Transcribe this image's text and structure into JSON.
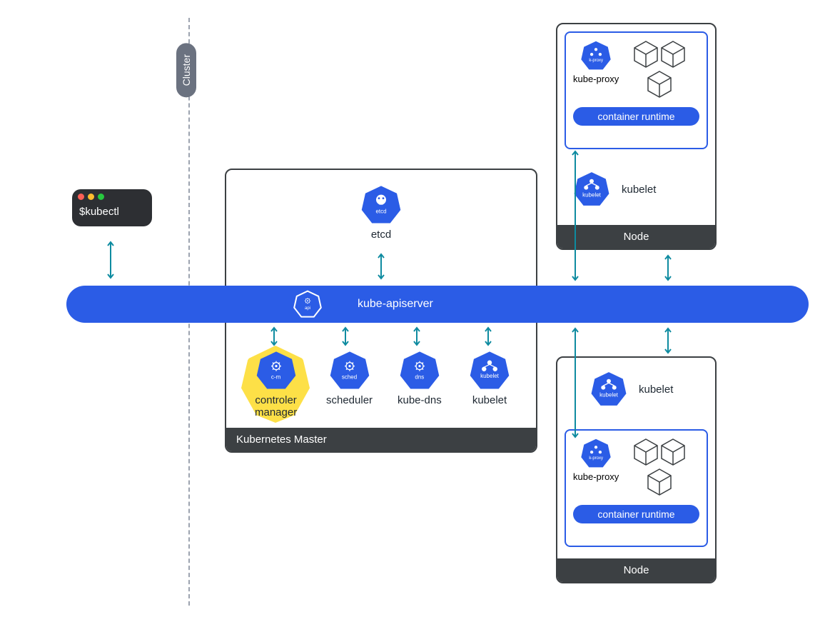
{
  "cluster_label": "Cluster",
  "kubectl": {
    "text": "$kubectl"
  },
  "apiserver": {
    "label": "kube-apiserver",
    "icon_tag": "api"
  },
  "master": {
    "title": "Kubernetes Master",
    "etcd": {
      "label": "etcd",
      "tag": "etcd"
    },
    "components": [
      {
        "label": "controler\nmanager",
        "tag": "c-m",
        "highlight": true
      },
      {
        "label": "scheduler",
        "tag": "sched",
        "highlight": false
      },
      {
        "label": "kube-dns",
        "tag": "dns",
        "highlight": false
      },
      {
        "label": "kubelet",
        "tag": "kubelet",
        "highlight": false
      }
    ]
  },
  "node_top": {
    "title": "Node",
    "kube_proxy": {
      "label": "kube-proxy",
      "tag": "k-proxy"
    },
    "runtime": "container runtime",
    "kubelet": {
      "label": "kubelet",
      "tag": "kubelet"
    }
  },
  "node_bottom": {
    "title": "Node",
    "kube_proxy": {
      "label": "kube-proxy",
      "tag": "k-proxy"
    },
    "runtime": "container runtime",
    "kubelet": {
      "label": "kubelet",
      "tag": "kubelet"
    }
  },
  "colors": {
    "blue": "#2b5ce6",
    "dark": "#3c4043",
    "teal": "#0e8ba0",
    "yellow": "#fde047"
  }
}
